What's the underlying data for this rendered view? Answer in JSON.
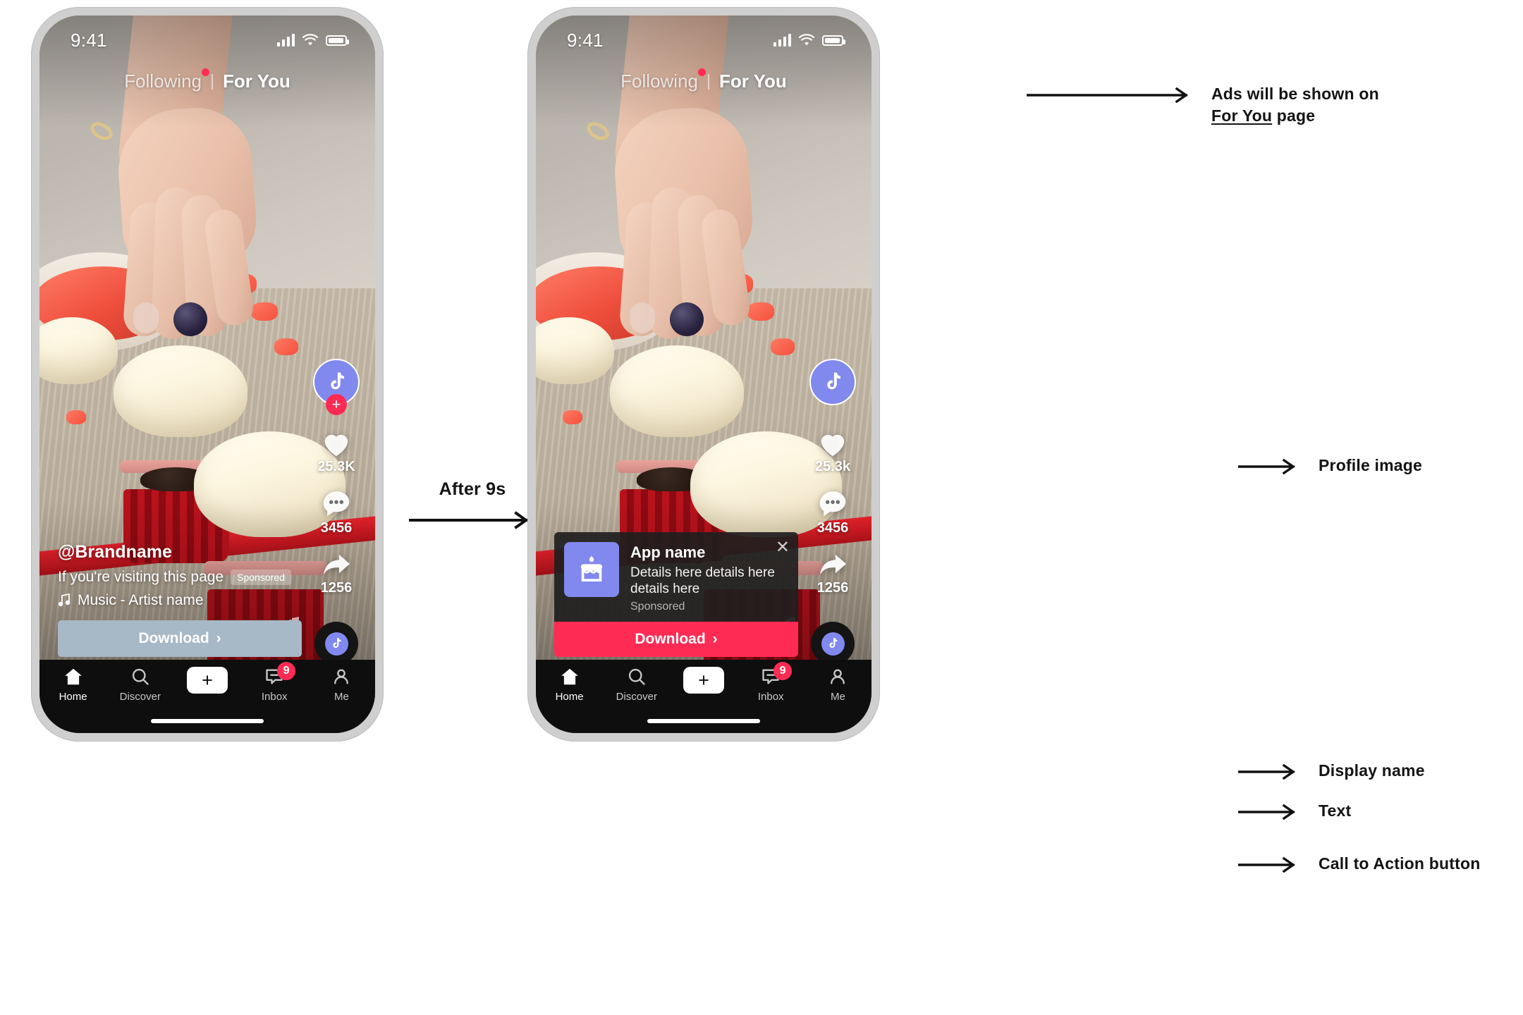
{
  "meta": {
    "transition_label": "After 9s"
  },
  "status_bar": {
    "time": "9:41",
    "signal_icon": "cellular-bars-icon",
    "wifi_icon": "wifi-icon",
    "battery_icon": "battery-icon"
  },
  "top_tabs": {
    "following": "Following",
    "separator": "|",
    "for_you": "For You",
    "dot_color": "#fe2c55"
  },
  "action_rail": {
    "left": {
      "avatar_icon": "tiktok-note-icon",
      "follow_plus": "+",
      "like_icon": "heart-icon",
      "like_count": "25.3K",
      "comment_icon": "comment-bubble-icon",
      "comment_count": "3456",
      "share_icon": "share-arrow-icon",
      "share_count": "1256"
    },
    "right": {
      "avatar_icon": "tiktok-note-icon",
      "like_icon": "heart-icon",
      "like_count": "25.3k",
      "comment_icon": "comment-bubble-icon",
      "comment_count": "3456",
      "share_icon": "share-arrow-icon",
      "share_count": "1256"
    }
  },
  "caption": {
    "username": "@Brandname",
    "text": "If you're visiting this page",
    "sponsored_badge": "Sponsored",
    "music_icon": "music-note-icon",
    "music": "Music - Artist name"
  },
  "download_plain": {
    "label": "Download",
    "chevron": "›",
    "bg_color": "#a7b8c6"
  },
  "ad_card": {
    "app_icon": "birthday-cake-icon",
    "app_name": "App name",
    "description": "Details here details here details here",
    "sponsored": "Sponsored",
    "close_icon": "close-icon",
    "cta_label": "Download",
    "cta_chevron": "›",
    "cta_color": "#fe2c55",
    "icon_color": "#8189ee"
  },
  "bottom_nav": {
    "items": [
      {
        "label": "Home",
        "icon": "home-icon"
      },
      {
        "label": "Discover",
        "icon": "search-icon"
      },
      {
        "label": "",
        "icon": "create-plus-icon"
      },
      {
        "label": "Inbox",
        "icon": "inbox-icon",
        "badge": "9"
      },
      {
        "label": "Me",
        "icon": "person-icon"
      }
    ],
    "create_plus": "+"
  },
  "annotations": [
    {
      "id": "ads-for-you",
      "line1": "Ads will be shown on",
      "link": "For You",
      "line2_tail": " page"
    },
    {
      "id": "profile",
      "text": "Profile image"
    },
    {
      "id": "display-name",
      "text": "Display name"
    },
    {
      "id": "body-text",
      "text": "Text"
    },
    {
      "id": "cta",
      "text": "Call to Action button"
    }
  ]
}
